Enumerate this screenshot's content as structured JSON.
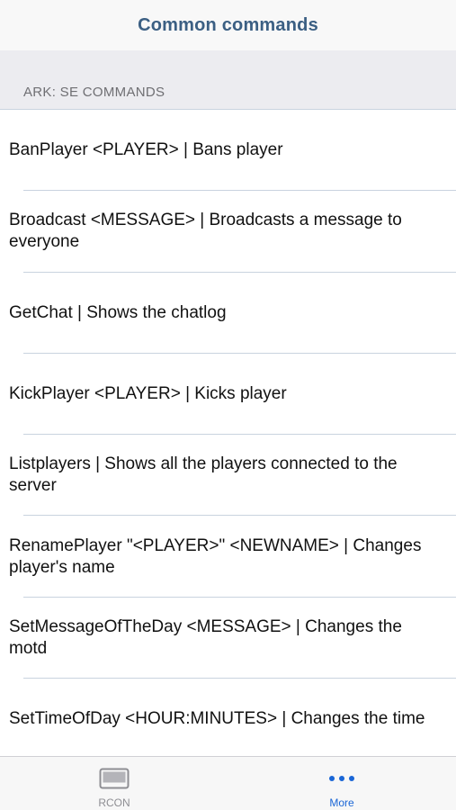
{
  "navbar": {
    "title": "Common commands"
  },
  "section": {
    "label": "ARK: SE COMMANDS"
  },
  "commands": [
    "BanPlayer <PLAYER> | Bans player",
    "Broadcast <MESSAGE> | Broadcasts a message to everyone",
    "GetChat | Shows the chatlog",
    "KickPlayer <PLAYER> | Kicks player",
    "Listplayers | Shows all the players connected to the server",
    "RenamePlayer \"<PLAYER>\" <NEWNAME> | Changes player's name",
    "SetMessageOfTheDay <MESSAGE> |  Changes the motd",
    "SetTimeOfDay <HOUR:MINUTES> | Changes the time"
  ],
  "tabbar": {
    "tabs": [
      {
        "label": "RCON",
        "icon": "terminal-icon",
        "active": false,
        "color": "#8e8e93"
      },
      {
        "label": "More",
        "icon": "more-icon",
        "active": true,
        "color": "#1a66d6"
      }
    ]
  },
  "colors": {
    "title": "#3b5f83",
    "accent": "#1a66d6",
    "separator": "#c9d3df"
  }
}
